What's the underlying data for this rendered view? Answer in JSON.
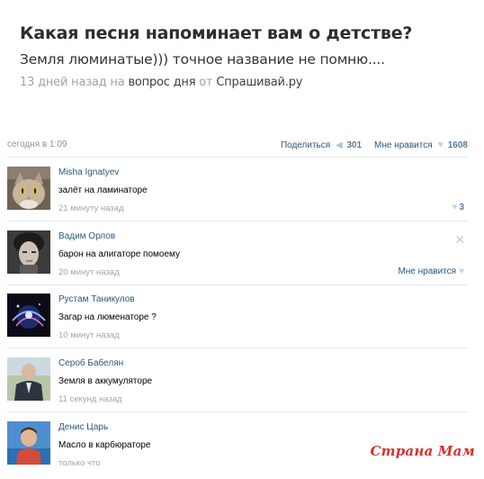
{
  "question": {
    "title": "Какая песня напоминает вам о детстве?",
    "answer": "Земля люминатые))) точное название не помню....",
    "meta_time": "13 дней назад",
    "meta_on": "на",
    "meta_section": "вопрос дня",
    "meta_from": "от",
    "meta_source": "Спрашивай.ру"
  },
  "post": {
    "date": "сегодня в 1:09",
    "share_label": "Поделиться",
    "share_count": "301",
    "like_label": "Мне нравится",
    "like_count": "1608",
    "share_icon": "megaphone-icon",
    "like_icon": "heart-icon"
  },
  "comments": [
    {
      "author": "Misha Ignatyev",
      "text": "залёт на ламинаторе",
      "time": "21 минуту назад",
      "likes": "3",
      "avatar": "cat-avatar"
    },
    {
      "author": "Вадим Орлов",
      "text": "барон на алигаторе помоему",
      "time": "20 минут назад",
      "action": "Мне нравится",
      "close_icon": "close-icon",
      "avatar": "man-avatar"
    },
    {
      "author": "Рустам Таникулов",
      "text": "Загар на люменаторе ?",
      "time": "10 минут назад",
      "avatar": "abstract-avatar"
    },
    {
      "author": "Сероб Бабелян",
      "text": "Земля в аккумуляторе",
      "time": "11 секунд назад",
      "avatar": "man-suit-avatar"
    },
    {
      "author": "Денис Царь",
      "text": "Масло в карбюраторе",
      "time": "только что",
      "avatar": "boy-avatar"
    }
  ],
  "watermark": "Страна Мам",
  "colors": {
    "link": "#2b587a",
    "meta": "#9aa4b0",
    "watermark": "#d3322b",
    "divider": "#e4e8ed"
  }
}
